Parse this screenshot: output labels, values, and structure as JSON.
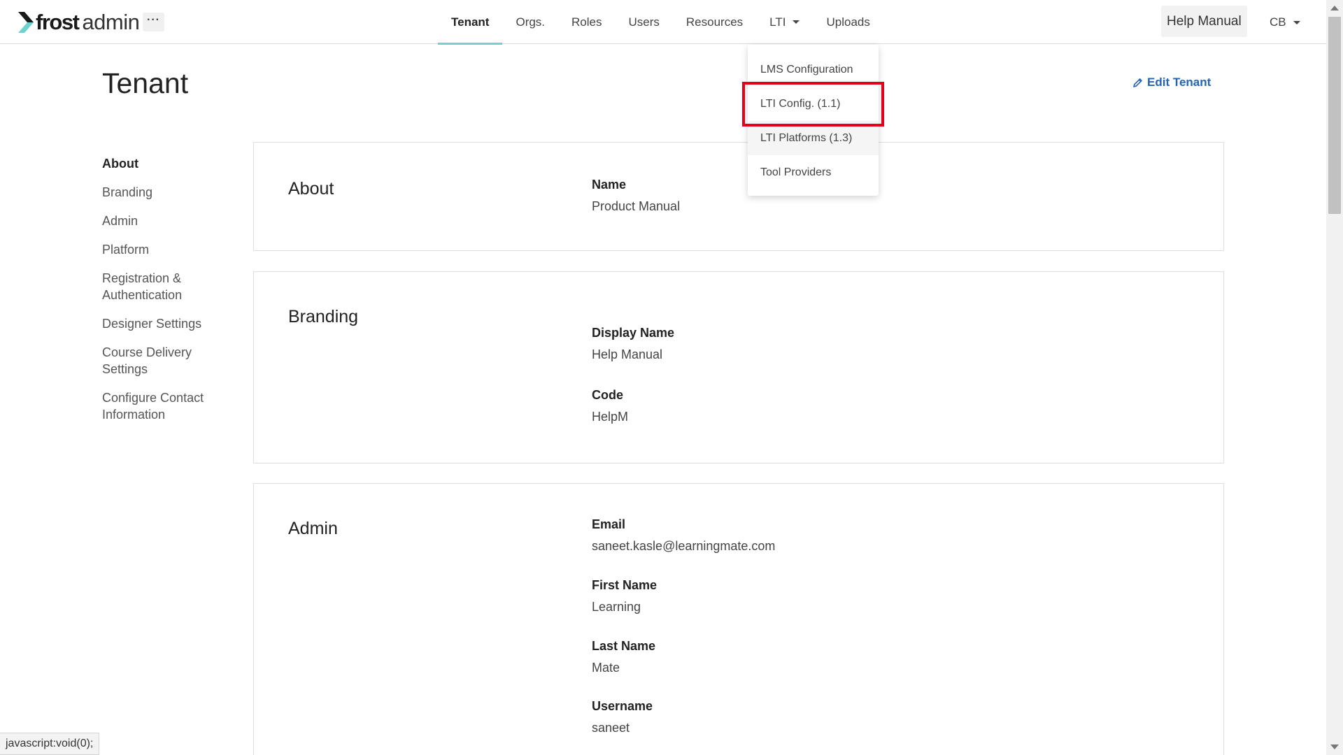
{
  "brand": {
    "word1": "frost",
    "word2": "admin",
    "accent": "#6ed3cf"
  },
  "more_button": {
    "label": "···",
    "icon": "ellipsis-icon"
  },
  "nav": {
    "tabs": [
      {
        "label": "Tenant",
        "active": true
      },
      {
        "label": "Orgs.",
        "active": false
      },
      {
        "label": "Roles",
        "active": false
      },
      {
        "label": "Users",
        "active": false
      },
      {
        "label": "Resources",
        "active": false
      },
      {
        "label": "LTI",
        "active": false,
        "has_dropdown": true
      },
      {
        "label": "Uploads",
        "active": false
      }
    ],
    "help_button": "Help Manual",
    "user_menu": "CB"
  },
  "lti_dropdown": {
    "items": [
      "LMS Configuration",
      "LTI Config. (1.1)",
      "LTI Platforms (1.3)",
      "Tool Providers"
    ],
    "highlight_color": "#e3001b"
  },
  "page": {
    "title": "Tenant",
    "edit_link": "Edit Tenant",
    "link_color": "#2563b5"
  },
  "sidenav": {
    "items": [
      "About",
      "Branding",
      "Admin",
      "Platform",
      "Registration & Authentication",
      "Designer Settings",
      "Course Delivery Settings",
      "Configure Contact Information"
    ]
  },
  "sections": {
    "about": {
      "title": "About",
      "fields": [
        {
          "label": "Name",
          "value": "Product Manual"
        }
      ]
    },
    "branding": {
      "title": "Branding",
      "fields": [
        {
          "label": "Display Name",
          "value": "Help Manual"
        },
        {
          "label": "Code",
          "value": "HelpM"
        }
      ]
    },
    "admin": {
      "title": "Admin",
      "fields": [
        {
          "label": "Email",
          "value": "saneet.kasle@learningmate.com"
        },
        {
          "label": "First Name",
          "value": "Learning"
        },
        {
          "label": "Last Name",
          "value": "Mate"
        },
        {
          "label": "Username",
          "value": "saneet"
        }
      ]
    }
  },
  "status_bar": "javascript:void(0);"
}
